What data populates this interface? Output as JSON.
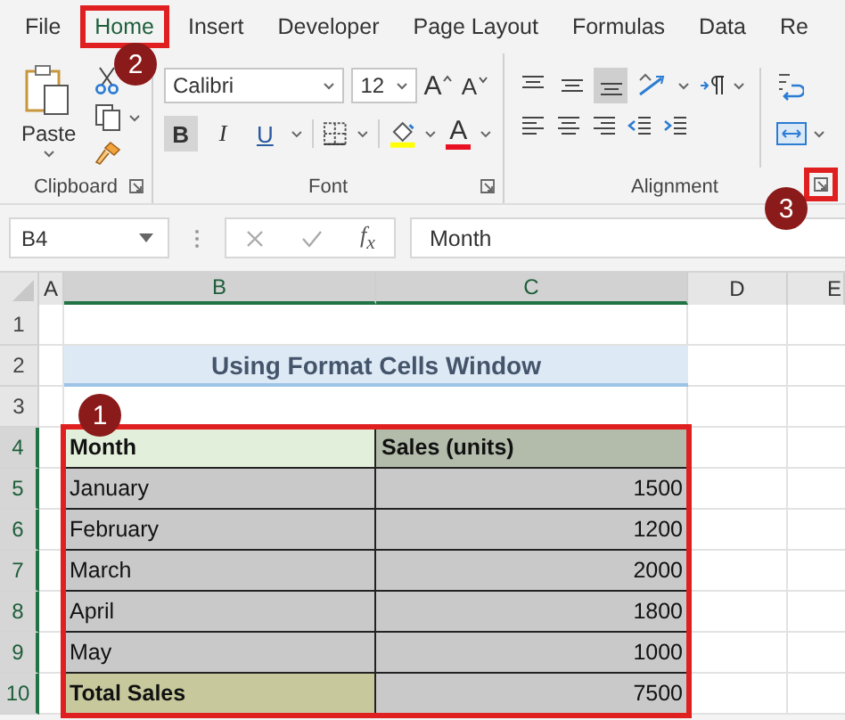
{
  "menu_tabs": [
    {
      "label": "File",
      "selected": false,
      "highlighted": false
    },
    {
      "label": "Home",
      "selected": true,
      "highlighted": true
    },
    {
      "label": "Insert",
      "selected": false,
      "highlighted": false
    },
    {
      "label": "Developer",
      "selected": false,
      "highlighted": false
    },
    {
      "label": "Page Layout",
      "selected": false,
      "highlighted": false
    },
    {
      "label": "Formulas",
      "selected": false,
      "highlighted": false
    },
    {
      "label": "Data",
      "selected": false,
      "highlighted": false
    },
    {
      "label": "Re",
      "selected": false,
      "highlighted": false
    }
  ],
  "ribbon": {
    "clipboard": {
      "label": "Clipboard",
      "paste_label": "Paste"
    },
    "font": {
      "label": "Font",
      "font_name": "Calibri",
      "font_size": "12",
      "grow_label": "A",
      "shrink_label": "A",
      "font_color_label": "A",
      "style_buttons": [
        {
          "label": "B",
          "kind": "bold",
          "selected": true
        },
        {
          "label": "I",
          "kind": "italic",
          "selected": false
        },
        {
          "label": "U",
          "kind": "underline",
          "selected": false
        }
      ]
    },
    "alignment": {
      "label": "Alignment",
      "launcher_highlighted": true,
      "vertical_buttons": [
        {
          "selected": false
        },
        {
          "selected": false
        },
        {
          "selected": true
        }
      ]
    }
  },
  "formula_bar": {
    "name_box": "B4",
    "fx": "f$_{x}$",
    "formula": "Month"
  },
  "columns": [
    {
      "label": "A",
      "selected": false
    },
    {
      "label": "B",
      "selected": true
    },
    {
      "label": "C",
      "selected": true
    },
    {
      "label": "D",
      "selected": false
    },
    {
      "label": "E",
      "selected": false
    }
  ],
  "rows": [
    {
      "label": "1",
      "selected": false
    },
    {
      "label": "2",
      "selected": false
    },
    {
      "label": "3",
      "selected": false
    },
    {
      "label": "4",
      "selected": true
    },
    {
      "label": "5",
      "selected": true
    },
    {
      "label": "6",
      "selected": true
    },
    {
      "label": "7",
      "selected": true
    },
    {
      "label": "8",
      "selected": true
    },
    {
      "label": "9",
      "selected": true
    },
    {
      "label": "10",
      "selected": true
    }
  ],
  "title_cell": "Using Format Cells Window",
  "table": {
    "highlighted": true,
    "header": [
      "Month",
      "Sales (units)"
    ],
    "rows": [
      {
        "kind": "data",
        "cells": [
          "January",
          "1500"
        ]
      },
      {
        "kind": "data",
        "cells": [
          "February",
          "1200"
        ]
      },
      {
        "kind": "data",
        "cells": [
          "March",
          "2000"
        ]
      },
      {
        "kind": "data",
        "cells": [
          "April",
          "1800"
        ]
      },
      {
        "kind": "data",
        "cells": [
          "May",
          "1000"
        ]
      },
      {
        "kind": "total",
        "cells": [
          "Total Sales",
          "7500"
        ]
      }
    ]
  },
  "callouts": [
    {
      "label": "1"
    },
    {
      "label": "2"
    },
    {
      "label": "3"
    }
  ]
}
